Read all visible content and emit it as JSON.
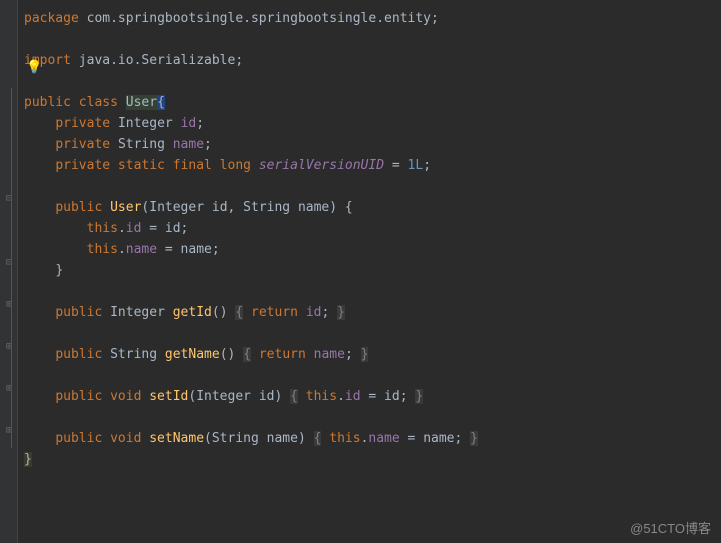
{
  "code": {
    "line1_kw": "package",
    "line1_pkg": " com.springbootsingle.springbootsingle.entity;",
    "line3_kw": "import",
    "line3_pkg": " java.io.Serializable;",
    "line5_kw": "public class ",
    "line5_class": "User",
    "line5_brace": "{",
    "line6_kw": "private ",
    "line6_type": "Integer ",
    "line6_field": "id",
    "line6_punct": ";",
    "line7_kw": "private ",
    "line7_type": "String ",
    "line7_field": "name",
    "line7_punct": ";",
    "line8_kw": "private static final long ",
    "line8_field": "serialVersionUID",
    "line8_eq": " = ",
    "line8_val": "1L",
    "line8_punct": ";",
    "line10_kw": "public ",
    "line10_ctor": "User",
    "line10_sig": "(Integer id, String name) {",
    "line11_this": "this",
    "line11_dot": ".",
    "line11_field": "id",
    "line11_eq": " = id;",
    "line12_this": "this",
    "line12_dot": ".",
    "line12_field": "name",
    "line12_eq": " = name;",
    "line13_brace": "}",
    "line15_kw": "public ",
    "line15_type": "Integer ",
    "line15_method": "getId",
    "line15_sig": "() ",
    "line15_br1": "{",
    "line15_ret": " return ",
    "line15_field": "id",
    "line15_end": "; ",
    "line15_br2": "}",
    "line17_kw": "public ",
    "line17_type": "String ",
    "line17_method": "getName",
    "line17_sig": "() ",
    "line17_br1": "{",
    "line17_ret": " return ",
    "line17_field": "name",
    "line17_end": "; ",
    "line17_br2": "}",
    "line19_kw": "public void ",
    "line19_method": "setId",
    "line19_sig": "(Integer id) ",
    "line19_br1": "{",
    "line19_this": " this",
    "line19_dot": ".",
    "line19_field": "id",
    "line19_eq": " = id; ",
    "line19_br2": "}",
    "line21_kw": "public void ",
    "line21_method": "setName",
    "line21_sig": "(String name) ",
    "line21_br1": "{",
    "line21_this": " this",
    "line21_dot": ".",
    "line21_field": "name",
    "line21_eq": " = name; ",
    "line21_br2": "}",
    "line22_brace": "}"
  },
  "bulb": "💡",
  "watermark": "@51CTO博客"
}
